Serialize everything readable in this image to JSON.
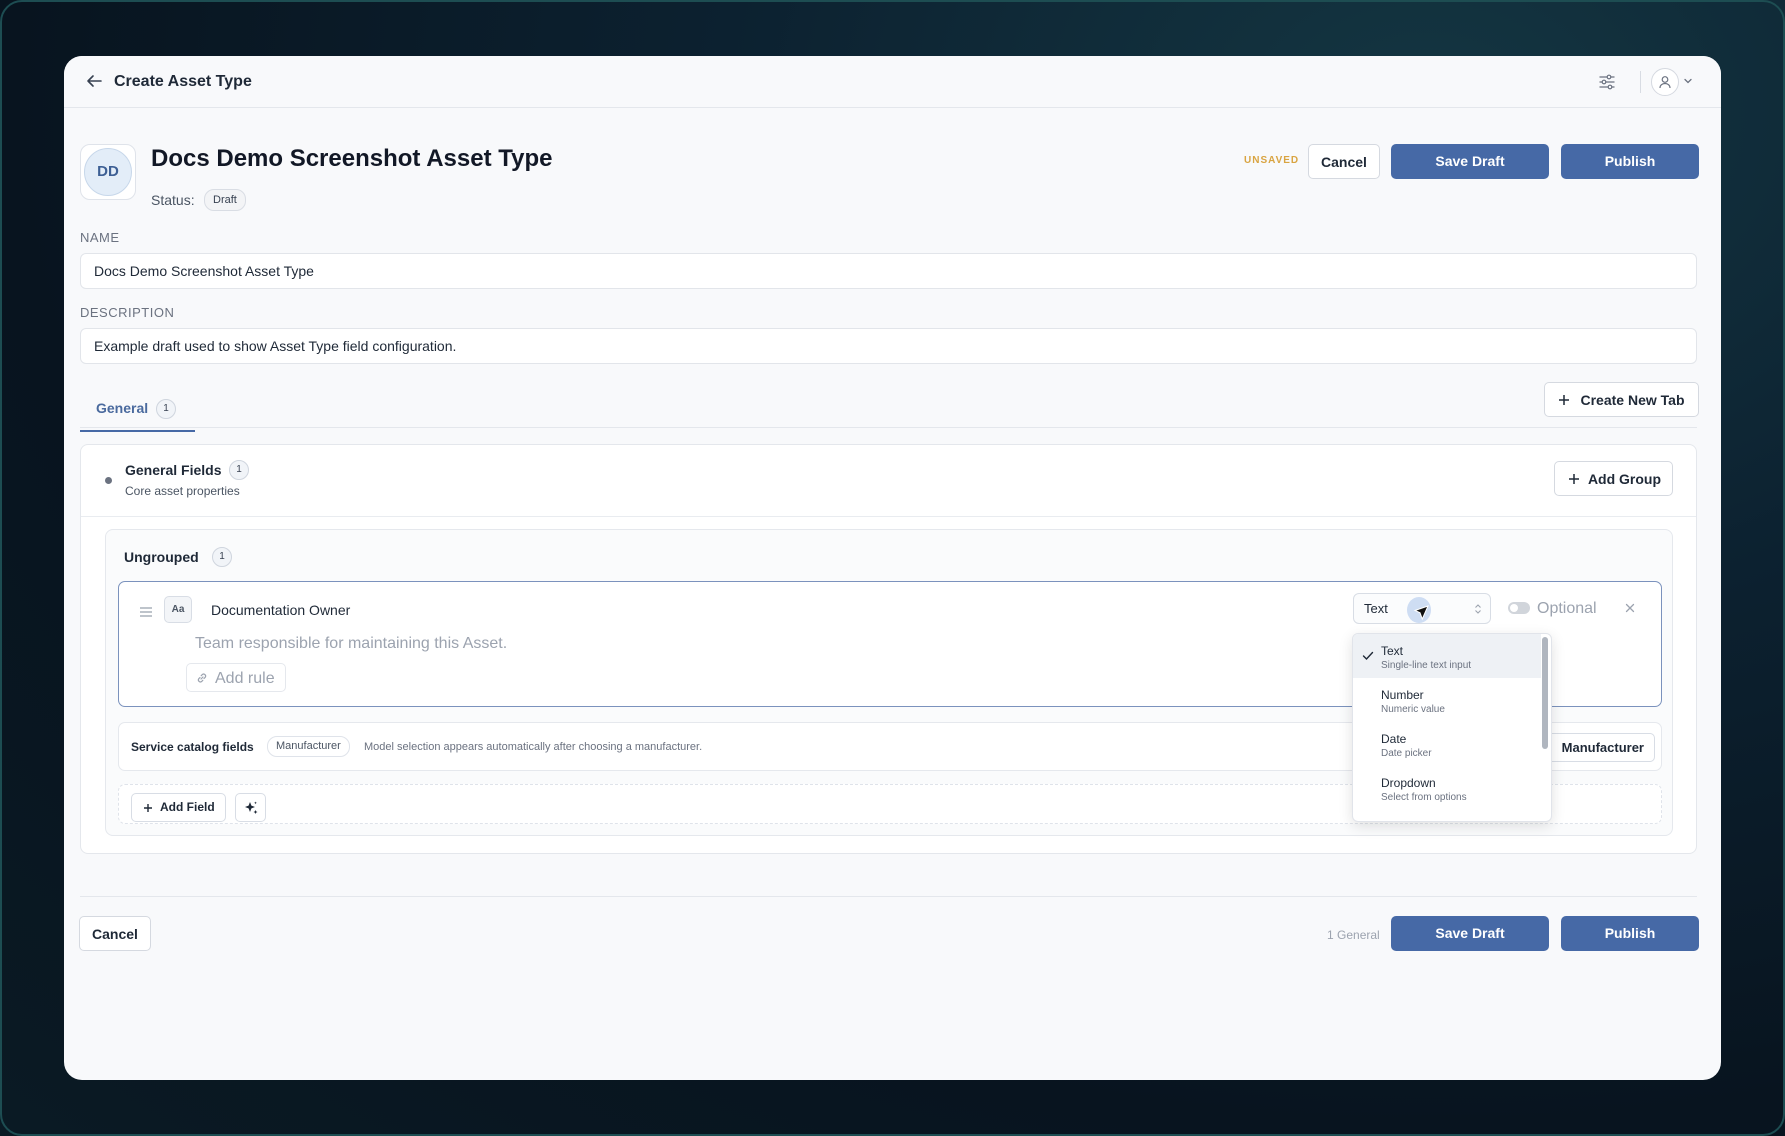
{
  "topbar": {
    "title": "Create Asset Type"
  },
  "header": {
    "avatar_initials": "DD",
    "asset_title": "Docs Demo Screenshot Asset Type",
    "status_label": "Status:",
    "status_value": "Draft",
    "unsaved_label": "UNSAVED",
    "cancel_label": "Cancel",
    "save_draft_label": "Save Draft",
    "publish_label": "Publish"
  },
  "form": {
    "name_label": "NAME",
    "name_value": "Docs Demo Screenshot Asset Type",
    "description_label": "DESCRIPTION",
    "description_value": "Example draft used to show Asset Type field configuration."
  },
  "tabs": {
    "items": [
      {
        "label": "General",
        "count": "1"
      }
    ],
    "create_tab_label": "Create New Tab"
  },
  "section": {
    "title": "General Fields",
    "count": "1",
    "subtitle": "Core asset properties",
    "add_group_label": "Add Group",
    "ungrouped": {
      "title": "Ungrouped",
      "count": "1",
      "field": {
        "icon_label": "Aa",
        "name": "Documentation Owner",
        "description_placeholder": "Team responsible for maintaining this Asset.",
        "add_rule_label": "Add rule",
        "type_value": "Text",
        "optional_label": "Optional"
      },
      "catalog": {
        "title": "Service catalog fields",
        "badge": "Manufacturer",
        "description": "Model selection appears automatically after choosing a manufacturer.",
        "button_label": "Manufacturer"
      },
      "add_field_label": "Add Field"
    }
  },
  "dropdown": {
    "options": [
      {
        "name": "Text",
        "description": "Single-line text input",
        "selected": true
      },
      {
        "name": "Number",
        "description": "Numeric value",
        "selected": false
      },
      {
        "name": "Date",
        "description": "Date picker",
        "selected": false
      },
      {
        "name": "Dropdown",
        "description": "Select from options",
        "selected": false
      }
    ]
  },
  "footer": {
    "cancel_label": "Cancel",
    "count_label": "1 General",
    "save_draft_label": "Save Draft",
    "publish_label": "Publish"
  },
  "colors": {
    "primary": "#4669a6",
    "unsaved": "#d9a441",
    "window_bg": "#f8f9fb"
  },
  "icons": [
    "back-arrow-icon",
    "filter-icon",
    "user-icon",
    "chevron-down-icon",
    "plus-icon",
    "drag-handle-icon",
    "text-type-icon",
    "link-icon",
    "updown-chevron-icon",
    "close-icon",
    "sparkle-icon",
    "check-icon",
    "cursor-icon"
  ]
}
